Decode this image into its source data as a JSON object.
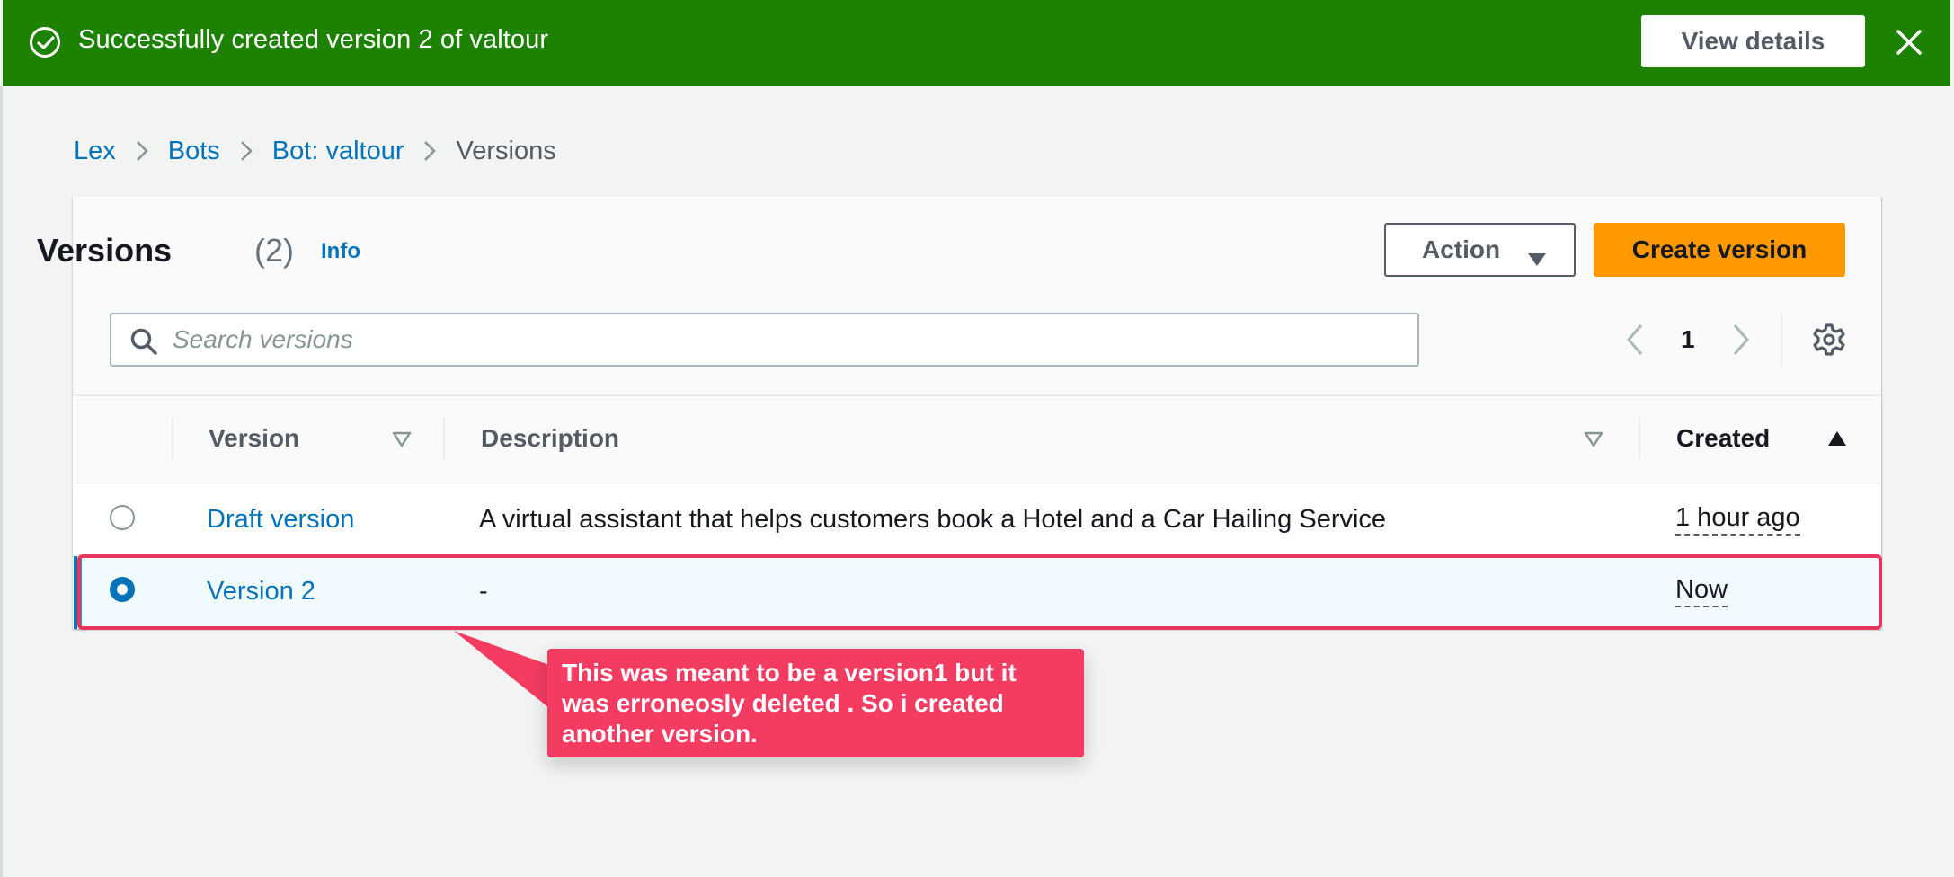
{
  "flash": {
    "message": "Successfully created version 2 of valtour",
    "view_details": "View details",
    "bg_color": "#1d8102"
  },
  "breadcrumb": {
    "items": [
      "Lex",
      "Bots",
      "Bot: valtour"
    ],
    "current": "Versions"
  },
  "header": {
    "title": "Versions",
    "count": "(2)",
    "info": "Info",
    "action_label": "Action",
    "create_label": "Create version"
  },
  "search": {
    "placeholder": "Search versions",
    "value": ""
  },
  "pagination": {
    "page": "1"
  },
  "table": {
    "columns": [
      "Version",
      "Description",
      "Created"
    ],
    "rows": [
      {
        "version": "Draft version",
        "description": "A virtual assistant that helps customers book a Hotel and a Car Hailing Service",
        "created": "1 hour ago",
        "selected": false
      },
      {
        "version": "Version 2",
        "description": "-",
        "created": "Now",
        "selected": true
      }
    ]
  },
  "annotation": {
    "text": "This was meant to be a version1 but it was erroneosly deleted . So i created another version.",
    "color": "#f43c62"
  },
  "colors": {
    "link": "#0073bb",
    "primary_button": "#ff9900"
  }
}
